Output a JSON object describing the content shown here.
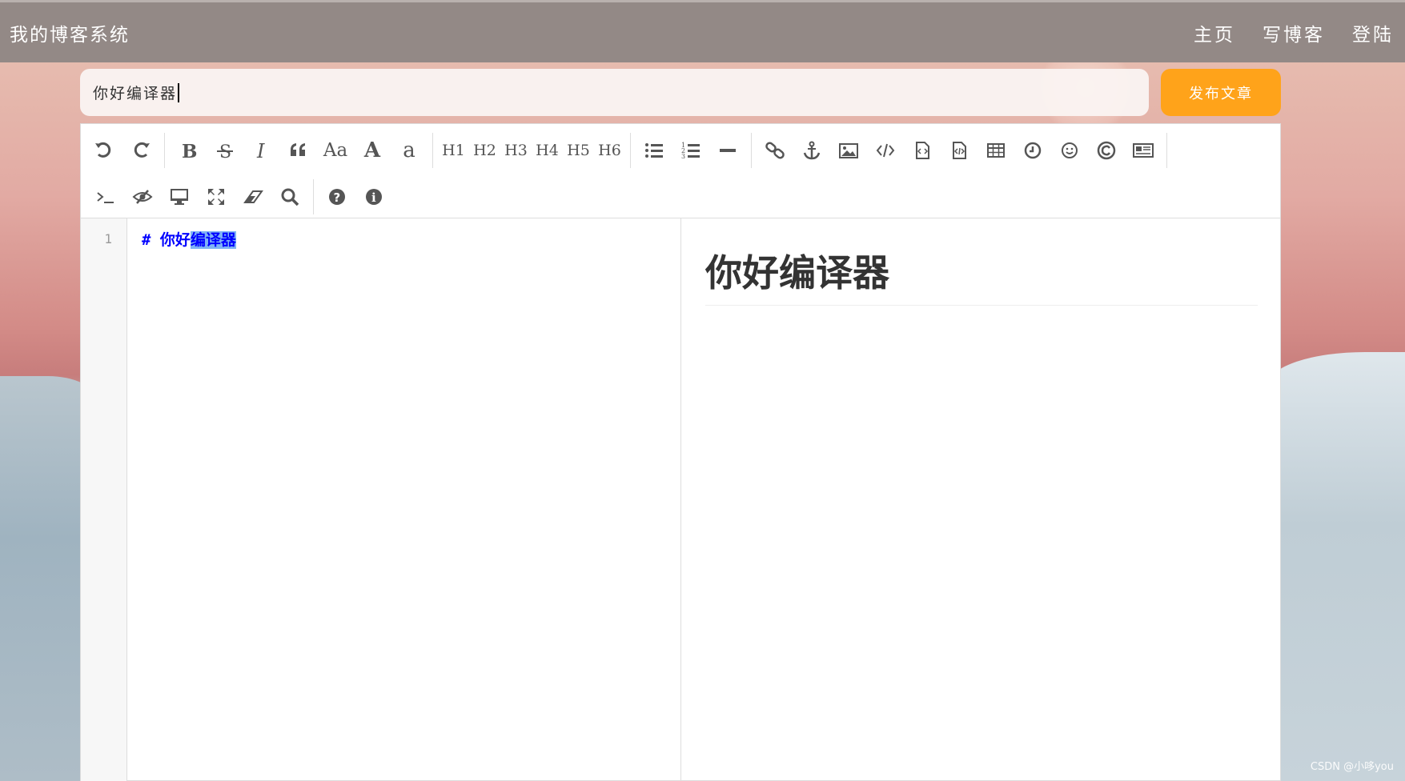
{
  "nav": {
    "brand": "我的博客系统",
    "links": [
      "主页",
      "写博客",
      "登陆"
    ]
  },
  "title_input": {
    "value": "你好编译器"
  },
  "publish_button": {
    "label": "发布文章"
  },
  "toolbar": {
    "row1": [
      {
        "name": "undo-icon"
      },
      {
        "name": "redo-icon"
      },
      {
        "sep": true
      },
      {
        "name": "bold-icon"
      },
      {
        "name": "strikethrough-icon"
      },
      {
        "name": "italic-icon"
      },
      {
        "name": "quote-icon"
      },
      {
        "name": "uppercase-icon",
        "text": "Aa"
      },
      {
        "name": "font-upper-icon",
        "text": "A"
      },
      {
        "name": "font-lower-icon",
        "text": "a"
      },
      {
        "sep": true
      },
      {
        "name": "h1-button",
        "text": "H1"
      },
      {
        "name": "h2-button",
        "text": "H2"
      },
      {
        "name": "h3-button",
        "text": "H3"
      },
      {
        "name": "h4-button",
        "text": "H4"
      },
      {
        "name": "h5-button",
        "text": "H5"
      },
      {
        "name": "h6-button",
        "text": "H6"
      },
      {
        "sep": true
      },
      {
        "name": "unordered-list-icon"
      },
      {
        "name": "ordered-list-icon"
      },
      {
        "name": "horizontal-rule-icon"
      },
      {
        "sep": true
      },
      {
        "name": "link-icon"
      },
      {
        "name": "anchor-icon"
      },
      {
        "name": "image-icon"
      },
      {
        "name": "code-icon"
      },
      {
        "name": "code-block-icon"
      },
      {
        "name": "preformatted-icon"
      },
      {
        "name": "table-icon"
      },
      {
        "name": "datetime-icon"
      },
      {
        "name": "emoji-icon"
      },
      {
        "name": "html-entities-icon"
      },
      {
        "name": "pagebreak-icon"
      },
      {
        "sep": true
      }
    ],
    "row2": [
      {
        "name": "terminal-icon"
      },
      {
        "name": "toggle-preview-icon"
      },
      {
        "name": "watch-icon"
      },
      {
        "name": "fullscreen-icon"
      },
      {
        "name": "clear-icon"
      },
      {
        "name": "search-icon"
      },
      {
        "sep": true
      },
      {
        "name": "help-icon"
      },
      {
        "name": "info-icon"
      }
    ]
  },
  "editor": {
    "line_number": "1",
    "code_prefix": "# 你好",
    "code_selected": "编译器"
  },
  "preview": {
    "heading": "你好编译器"
  },
  "watermark": "CSDN @小哆you"
}
